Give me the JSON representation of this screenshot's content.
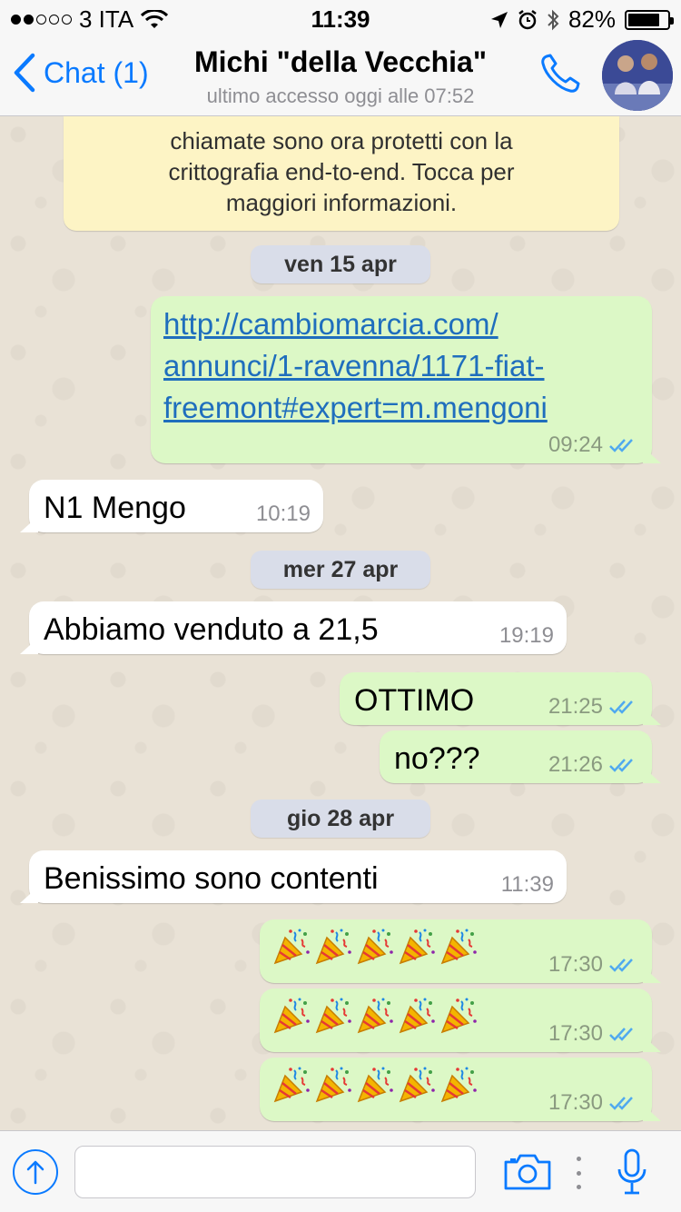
{
  "status_bar": {
    "carrier": "3 ITA",
    "time": "11:39",
    "battery": "82%",
    "battery_level": 0.82
  },
  "header": {
    "back_label": "Chat (1)",
    "contact_name": "Michi \"della Vecchia\"",
    "last_seen": "ultimo accesso oggi alle 07:52"
  },
  "notice": {
    "lines": [
      "chiamate sono ora protetti con la",
      "crittografia end-to-end. Tocca per",
      "maggiori informazioni."
    ]
  },
  "dates": [
    "ven 15 apr",
    "mer 27 apr",
    "gio 28 apr"
  ],
  "messages": [
    {
      "direction": "out",
      "link_lines": [
        "http://cambiomarcia.com/",
        "annunci/1-ravenna/1171-fiat-",
        "freemont#expert=m.mengoni"
      ],
      "time": "09:24"
    },
    {
      "direction": "in",
      "text": "N1 Mengo",
      "time": "10:19"
    },
    {
      "direction": "in",
      "text": "Abbiamo venduto a 21,5",
      "time": "19:19"
    },
    {
      "direction": "out",
      "text": "OTTIMO",
      "time": "21:25"
    },
    {
      "direction": "out",
      "text": "no???",
      "time": "21:26"
    },
    {
      "direction": "in",
      "text": "Benissimo sono contenti",
      "time": "11:39"
    },
    {
      "direction": "out",
      "emoji": "party-popper-x5",
      "time": "17:30"
    },
    {
      "direction": "out",
      "emoji": "party-popper-x5",
      "time": "17:30"
    },
    {
      "direction": "out",
      "emoji": "party-popper-x5",
      "time": "17:30"
    }
  ],
  "input": {
    "placeholder": ""
  },
  "colors": {
    "accent": "#0a7aff",
    "outgoing_bubble": "#dcf8c6",
    "incoming_bubble": "#ffffff",
    "notice_bg": "#fdf4c5",
    "read_ticks": "#4fa9ef"
  },
  "icons": [
    "location-arrow-icon",
    "alarm-icon",
    "bluetooth-icon",
    "wifi-icon",
    "phone-icon",
    "share-upload-icon",
    "camera-icon",
    "microphone-icon",
    "read-ticks-icon",
    "party-popper-icon"
  ]
}
